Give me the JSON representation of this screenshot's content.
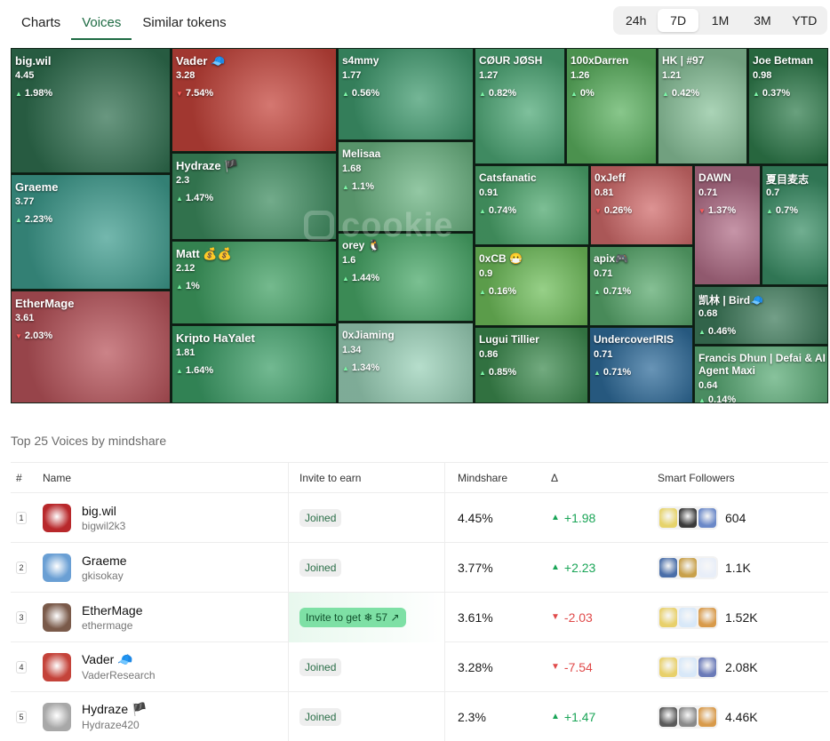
{
  "tabs": [
    {
      "label": "Charts",
      "active": false
    },
    {
      "label": "Voices",
      "active": true
    },
    {
      "label": "Similar tokens",
      "active": false
    }
  ],
  "ranges": [
    {
      "label": "24h",
      "active": false
    },
    {
      "label": "7D",
      "active": true
    },
    {
      "label": "1M",
      "active": false
    },
    {
      "label": "3M",
      "active": false
    },
    {
      "label": "YTD",
      "active": false
    }
  ],
  "treemap": {
    "watermark": "cookie",
    "tiles": [
      {
        "name": "big.wil",
        "mindshare": "4.45",
        "change": "1.98%",
        "dir": "up"
      },
      {
        "name": "Vader 🧢",
        "mindshare": "3.28",
        "change": "7.54%",
        "dir": "down"
      },
      {
        "name": "s4mmy",
        "mindshare": "1.77",
        "change": "0.56%",
        "dir": "up"
      },
      {
        "name": "CØUR JØSH",
        "mindshare": "1.27",
        "change": "0.82%",
        "dir": "up"
      },
      {
        "name": "100xDarren",
        "mindshare": "1.26",
        "change": "0%",
        "dir": "up"
      },
      {
        "name": "HK | #97",
        "mindshare": "1.21",
        "change": "0.42%",
        "dir": "up"
      },
      {
        "name": "Joe Betman",
        "mindshare": "0.98",
        "change": "0.37%",
        "dir": "up"
      },
      {
        "name": "Graeme",
        "mindshare": "3.77",
        "change": "2.23%",
        "dir": "up"
      },
      {
        "name": "Hydraze 🏴",
        "mindshare": "2.3",
        "change": "1.47%",
        "dir": "up"
      },
      {
        "name": "Melisaa",
        "mindshare": "1.68",
        "change": "1.1%",
        "dir": "up"
      },
      {
        "name": "Catsfanatic",
        "mindshare": "0.91",
        "change": "0.74%",
        "dir": "up"
      },
      {
        "name": "0xJeff",
        "mindshare": "0.81",
        "change": "0.26%",
        "dir": "down"
      },
      {
        "name": "DAWN",
        "mindshare": "0.71",
        "change": "1.37%",
        "dir": "down"
      },
      {
        "name": "夏目麦志",
        "mindshare": "0.7",
        "change": "0.7%",
        "dir": "up"
      },
      {
        "name": "Matt 💰💰",
        "mindshare": "2.12",
        "change": "1%",
        "dir": "up"
      },
      {
        "name": "orey 🐧",
        "mindshare": "1.6",
        "change": "1.44%",
        "dir": "up"
      },
      {
        "name": "0xCB 😷",
        "mindshare": "0.9",
        "change": "0.16%",
        "dir": "up"
      },
      {
        "name": "apix🎮",
        "mindshare": "0.71",
        "change": "0.71%",
        "dir": "up"
      },
      {
        "name": "凯林 | Bird🧢",
        "mindshare": "0.68",
        "change": "0.46%",
        "dir": "up"
      },
      {
        "name": "EtherMage",
        "mindshare": "3.61",
        "change": "2.03%",
        "dir": "down"
      },
      {
        "name": "Kripto HaYalet",
        "mindshare": "1.81",
        "change": "1.64%",
        "dir": "up"
      },
      {
        "name": "0xJiaming",
        "mindshare": "1.34",
        "change": "1.34%",
        "dir": "up"
      },
      {
        "name": "Lugui Tillier",
        "mindshare": "0.86",
        "change": "0.85%",
        "dir": "up"
      },
      {
        "name": "UndercoverIRIS",
        "mindshare": "0.71",
        "change": "0.71%",
        "dir": "up"
      },
      {
        "name": "Francis Dhun | Defai & AI Agent Maxi",
        "mindshare": "0.64",
        "change": "0.14%",
        "dir": "up"
      }
    ]
  },
  "section_title": "Top 25 Voices by mindshare",
  "table": {
    "headers": {
      "idx": "#",
      "name": "Name",
      "invite": "Invite to earn",
      "mindshare": "Mindshare",
      "delta": "Δ",
      "followers": "Smart Followers"
    },
    "rows": [
      {
        "idx": "1",
        "name": "big.wil",
        "handle": "bigwil2k3",
        "invite": "Joined",
        "invite_type": "joined",
        "mindshare": "4.45%",
        "delta": "+1.98",
        "dir": "up",
        "followers": "604"
      },
      {
        "idx": "2",
        "name": "Graeme",
        "handle": "gkisokay",
        "invite": "Joined",
        "invite_type": "joined",
        "mindshare": "3.77%",
        "delta": "+2.23",
        "dir": "up",
        "followers": "1.1K"
      },
      {
        "idx": "3",
        "name": "EtherMage",
        "handle": "ethermage",
        "invite": "Invite to get ❄ 57 ↗",
        "invite_type": "invite",
        "mindshare": "3.61%",
        "delta": "-2.03",
        "dir": "down",
        "followers": "1.52K"
      },
      {
        "idx": "4",
        "name": "Vader 🧢",
        "handle": "VaderResearch",
        "invite": "Joined",
        "invite_type": "joined",
        "mindshare": "3.28%",
        "delta": "-7.54",
        "dir": "down",
        "followers": "2.08K"
      },
      {
        "idx": "5",
        "name": "Hydraze 🏴",
        "handle": "Hydraze420",
        "invite": "Joined",
        "invite_type": "joined",
        "mindshare": "2.3%",
        "delta": "+1.47",
        "dir": "up",
        "followers": "4.46K"
      }
    ]
  },
  "colors": {
    "accent": "#1e6b43",
    "up": "#1aa557",
    "down": "#e04a4a",
    "tile_green": "#2f8f57",
    "tile_red": "#b8443a"
  }
}
